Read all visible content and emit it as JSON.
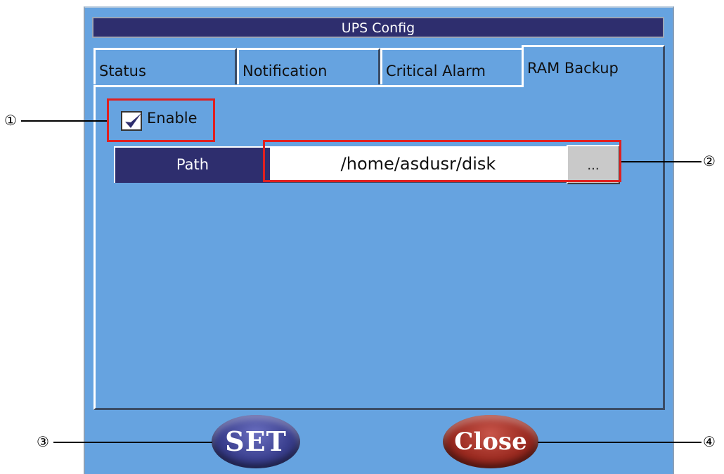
{
  "window": {
    "title": "UPS Config"
  },
  "tabs": [
    {
      "label": "Status",
      "active": false
    },
    {
      "label": "Notification",
      "active": false
    },
    {
      "label": "Critical Alarm",
      "active": false
    },
    {
      "label": "RAM Backup",
      "active": true
    }
  ],
  "ram_backup": {
    "enable_label": "Enable",
    "enable_checked": true,
    "path_label": "Path",
    "path_value": "/home/asdusr/disk",
    "browse_label": "..."
  },
  "buttons": {
    "set_label": "SET",
    "close_label": "Close"
  },
  "callouts": [
    "①",
    "②",
    "③",
    "④"
  ],
  "colors": {
    "dialog_bg": "#66a3e0",
    "title_bg": "#2e2e6e",
    "highlight": "#e02020",
    "set_button": "#3a3f8e",
    "close_button": "#9a2a20"
  }
}
